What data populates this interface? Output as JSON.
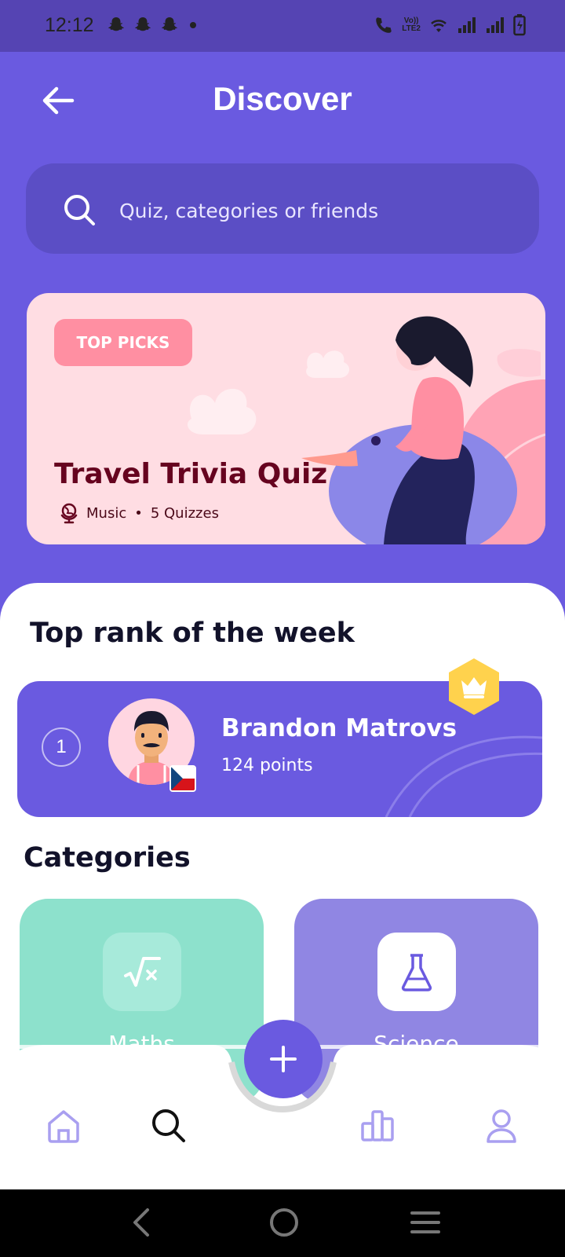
{
  "status_bar": {
    "time": "12:12",
    "lte_top": "Vo))",
    "lte_bottom": "LTE2"
  },
  "header": {
    "title": "Discover"
  },
  "search": {
    "placeholder": "Quiz, categories or friends"
  },
  "featured": {
    "badge": "TOP PICKS",
    "title": "Travel Trivia Quiz",
    "category": "Music",
    "separator": "•",
    "count": "5 Quizzes"
  },
  "top_rank": {
    "section_title": "Top rank of the week",
    "rank": "1",
    "name": "Brandon Matrovs",
    "points": "124 points"
  },
  "categories": {
    "section_title": "Categories",
    "items": [
      {
        "label": "Maths",
        "icon": "square-root-icon"
      },
      {
        "label": "Science",
        "icon": "flask-icon"
      }
    ]
  },
  "bottom_nav": {
    "items": [
      "home-icon",
      "search-icon",
      "add-icon",
      "leaderboard-icon",
      "profile-icon"
    ],
    "active": "search"
  },
  "colors": {
    "primary": "#6A5AE0",
    "featured_bg": "#FFDDE3",
    "badge": "#FF8FA2",
    "maths": "#8DE1CC",
    "science": "#9086E3",
    "crown": "#FFD24D"
  }
}
